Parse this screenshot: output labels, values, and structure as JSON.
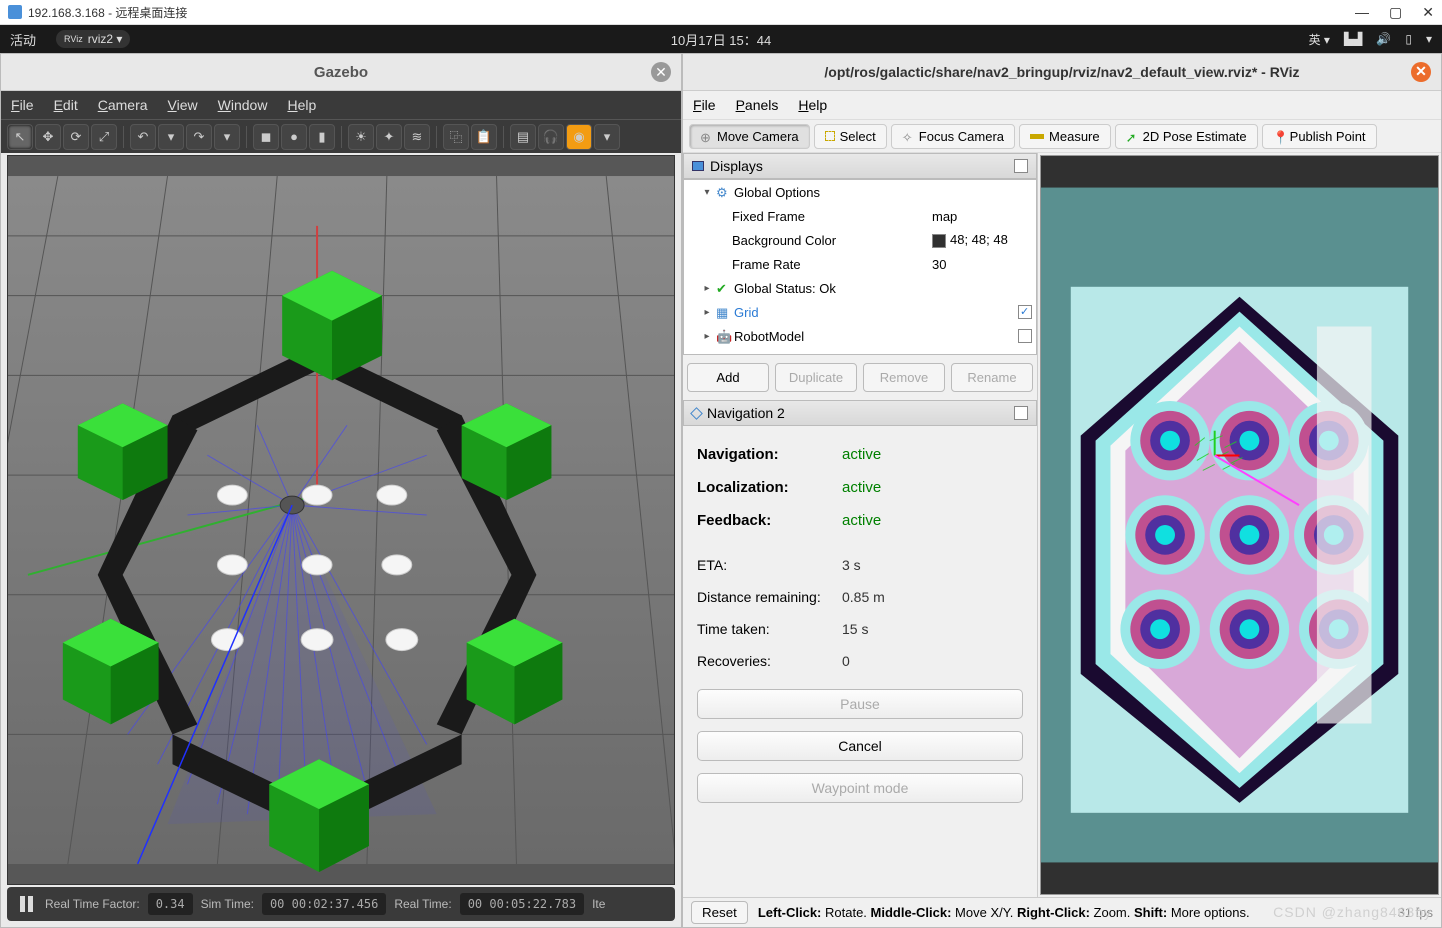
{
  "win": {
    "title": "192.168.3.168 - 远程桌面连接",
    "min": "—",
    "max": "▢",
    "close": "✕"
  },
  "gnome": {
    "activities": "活动",
    "app": "rviz2 ▾",
    "clock": "10月17日  15：44",
    "lang": "英 ▾"
  },
  "gazebo": {
    "title": "Gazebo",
    "menu": {
      "file": "File",
      "edit": "Edit",
      "camera": "Camera",
      "view": "View",
      "window": "Window",
      "help": "Help"
    },
    "status": {
      "rtf_label": "Real Time Factor:",
      "rtf_value": "0.34",
      "simtime_label": "Sim Time:",
      "simtime_value": "00 00:02:37.456",
      "realtime_label": "Real Time:",
      "realtime_value": "00 00:05:22.783",
      "iter_label": "Ite"
    }
  },
  "rviz": {
    "title": "/opt/ros/galactic/share/nav2_bringup/rviz/nav2_default_view.rviz* - RViz",
    "menu": {
      "file": "File",
      "panels": "Panels",
      "help": "Help"
    },
    "tools": {
      "move_camera": "Move Camera",
      "select": "Select",
      "focus_camera": "Focus Camera",
      "measure": "Measure",
      "pose_estimate": "2D Pose Estimate",
      "publish_point": "Publish Point"
    },
    "displays_label": "Displays",
    "tree": {
      "global_options": "Global Options",
      "fixed_frame_k": "Fixed Frame",
      "fixed_frame_v": "map",
      "bg_color_k": "Background Color",
      "bg_color_v": "48; 48; 48",
      "frame_rate_k": "Frame Rate",
      "frame_rate_v": "30",
      "global_status": "Global Status: Ok",
      "grid": "Grid",
      "robot_model": "RobotModel"
    },
    "buttons": {
      "add": "Add",
      "duplicate": "Duplicate",
      "remove": "Remove",
      "rename": "Rename"
    },
    "nav2_label": "Navigation 2",
    "nav2": {
      "navigation_k": "Navigation:",
      "navigation_v": "active",
      "localization_k": "Localization:",
      "localization_v": "active",
      "feedback_k": "Feedback:",
      "feedback_v": "active",
      "eta_k": "ETA:",
      "eta_v": "3 s",
      "dist_k": "Distance remaining:",
      "dist_v": "0.85 m",
      "time_k": "Time taken:",
      "time_v": "15 s",
      "recov_k": "Recoveries:",
      "recov_v": "0",
      "pause_btn": "Pause",
      "cancel_btn": "Cancel",
      "waypoint_btn": "Waypoint mode"
    },
    "footer": {
      "reset": "Reset",
      "left_b": "Left-Click:",
      "left_t": " Rotate. ",
      "mid_b": "Middle-Click:",
      "mid_t": " Move X/Y. ",
      "right_b": "Right-Click:",
      "right_t": " Zoom. ",
      "shift_b": "Shift:",
      "shift_t": " More options."
    },
    "watermark": "CSDN @zhang8463by"
  }
}
